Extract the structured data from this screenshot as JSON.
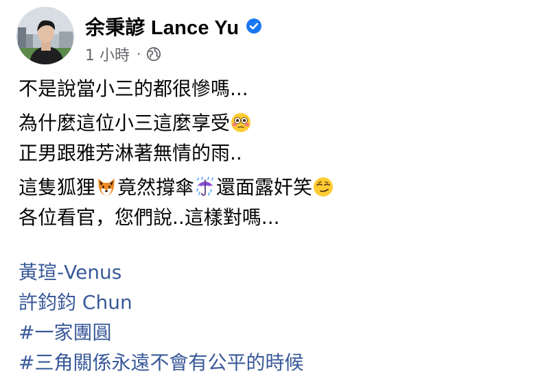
{
  "post": {
    "author_name": "余秉諺 Lance Yu",
    "timestamp": "1 小時",
    "separator": "·",
    "audience_icon": "globe-icon",
    "verified_icon": "verified-badge-icon",
    "lines": {
      "l1": "不是說當小三的都很慘嗎...",
      "l2": "為什麼這位小三這麼享受",
      "l3": "正男跟雅芳淋著無情的雨..",
      "l4a": "這隻狐狸",
      "l4b": "竟然撐傘",
      "l4c": "還面露奸笑",
      "l5": "各位看官，您們說..這樣對嗎..."
    },
    "emojis": {
      "flushed": "flushed-face-emoji",
      "fox": "fox-face-emoji",
      "umbrella": "umbrella-with-rain-emoji",
      "smirk": "smirking-face-emoji"
    },
    "tags": {
      "mention1": "黃瑄-Venus",
      "mention2": "許鈞鈞 Chun",
      "hashtag1": "#一家團圓",
      "hashtag2": "#三角關係永遠不會有公平的時候"
    },
    "colors": {
      "link": "#385898",
      "verified": "#1877f2",
      "meta": "#65676b",
      "text": "#050505"
    }
  }
}
